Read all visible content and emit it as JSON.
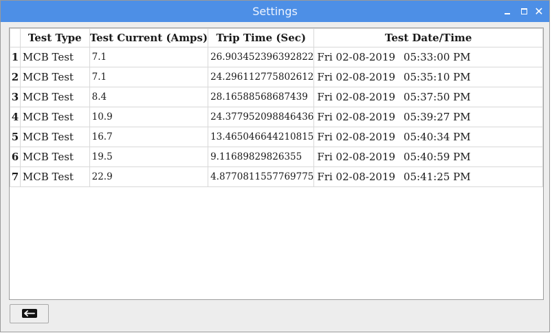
{
  "window": {
    "title": "Settings"
  },
  "table": {
    "headers": {
      "row_num": "",
      "test_type": "Test Type",
      "test_current": "Test Current (Amps)",
      "trip_time": "Trip Time (Sec)",
      "date_time": "Test Date/Time"
    },
    "rows": [
      {
        "num": "1",
        "type": "MCB Test",
        "current": "7.1",
        "trip": "26.903452396392822",
        "date": "Fri 02-08-2019",
        "time": "05:33:00 PM"
      },
      {
        "num": "2",
        "type": "MCB Test",
        "current": "7.1",
        "trip": "24.296112775802612",
        "date": "Fri 02-08-2019",
        "time": "05:35:10 PM"
      },
      {
        "num": "3",
        "type": "MCB Test",
        "current": "8.4",
        "trip": "28.16588568687439",
        "date": "Fri 02-08-2019",
        "time": "05:37:50 PM"
      },
      {
        "num": "4",
        "type": "MCB Test",
        "current": "10.9",
        "trip": "24.377952098846436",
        "date": "Fri 02-08-2019",
        "time": "05:39:27 PM"
      },
      {
        "num": "5",
        "type": "MCB Test",
        "current": "16.7",
        "trip": "13.465046644210815",
        "date": "Fri 02-08-2019",
        "time": "05:40:34 PM"
      },
      {
        "num": "6",
        "type": "MCB Test",
        "current": "19.5",
        "trip": "9.11689829826355",
        "date": "Fri 02-08-2019",
        "time": "05:40:59 PM"
      },
      {
        "num": "7",
        "type": "MCB Test",
        "current": "22.9",
        "trip": "4.8770811557769775",
        "date": "Fri 02-08-2019",
        "time": "05:41:25 PM"
      }
    ]
  },
  "icons": {
    "minimize": "minimize-icon",
    "maximize": "maximize-icon",
    "close": "close-icon",
    "back": "arrow-left-icon"
  },
  "colors": {
    "titlebar": "#4d8fe6",
    "window_bg": "#ededed",
    "grid": "#d8d8d8"
  }
}
